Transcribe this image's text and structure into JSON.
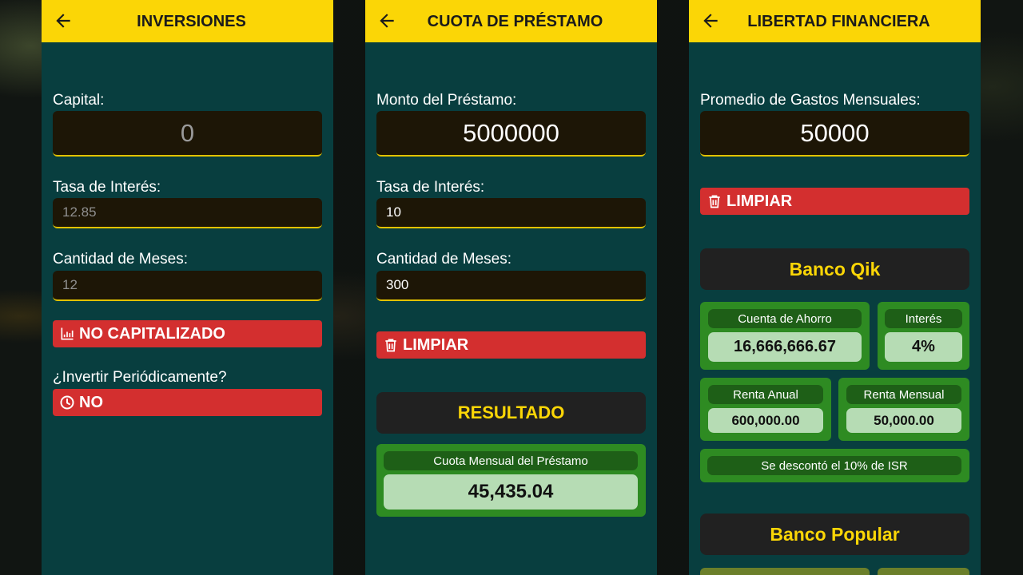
{
  "panels": {
    "inversiones": {
      "title": "INVERSIONES",
      "capital_label": "Capital:",
      "capital_value": "0",
      "tasa_label": "Tasa de Interés:",
      "tasa_placeholder": "12.85",
      "meses_label": "Cantidad de Meses:",
      "meses_placeholder": "12",
      "capitalizado_button": "NO CAPITALIZADO",
      "periodico_label": "¿Invertir Periódicamente?",
      "periodico_button": "NO"
    },
    "cuota": {
      "title": "CUOTA DE PRÉSTAMO",
      "monto_label": "Monto del Préstamo:",
      "monto_value": "5000000",
      "tasa_label": "Tasa de Interés:",
      "tasa_value": "10",
      "meses_label": "Cantidad de Meses:",
      "meses_value": "300",
      "limpiar_button": "LIMPIAR",
      "resultado_heading": "RESULTADO",
      "cuota_label": "Cuota Mensual del Préstamo",
      "cuota_value": "45,435.04"
    },
    "libertad": {
      "title": "LIBERTAD FINANCIERA",
      "gastos_label": "Promedio de Gastos Mensuales:",
      "gastos_value": "50000",
      "limpiar_button": "LIMPIAR",
      "bank1": {
        "name": "Banco Qik",
        "ahorro_label": "Cuenta de Ahorro",
        "ahorro_value": "16,666,666.67",
        "interes_label": "Interés",
        "interes_value": "4%",
        "renta_anual_label": "Renta Anual",
        "renta_anual_value": "600,000.00",
        "renta_mensual_label": "Renta Mensual",
        "renta_mensual_value": "50,000.00",
        "isr_note": "Se descontó el 10% de ISR"
      },
      "bank2": {
        "name": "Banco Popular"
      }
    }
  },
  "colors": {
    "appbar": "#fbd606",
    "panel_bg": "#083e3f",
    "field_bg": "#1d1606",
    "red_button": "#d32f2f",
    "green_box": "#2e8b22",
    "green_label": "#1e5f17",
    "green_value": "#b6dcb4",
    "accent_text": "#fbd606"
  },
  "icons": {
    "back": "arrow-left-icon",
    "chart": "bar-chart-icon",
    "clock": "clock-icon",
    "trash": "trash-icon"
  }
}
